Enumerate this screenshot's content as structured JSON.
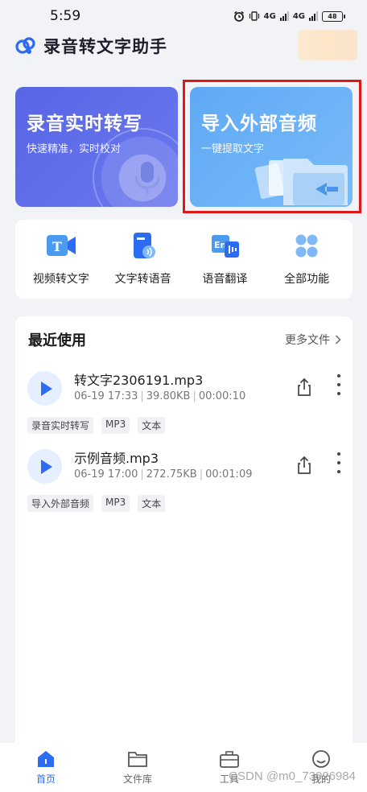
{
  "status": {
    "time": "5:59",
    "network1": "4G",
    "network2": "4G",
    "battery": "48"
  },
  "header": {
    "title": "录音转文字助手"
  },
  "cards": {
    "record": {
      "title": "录音实时转写",
      "subtitle": "快速精准，实时校对"
    },
    "import": {
      "title": "导入外部音频",
      "subtitle": "一键提取文字"
    }
  },
  "functions": [
    {
      "label": "视频转文字",
      "icon": "video-to-text-icon"
    },
    {
      "label": "文字转语音",
      "icon": "text-to-speech-icon"
    },
    {
      "label": "语音翻译",
      "icon": "voice-translate-icon"
    },
    {
      "label": "全部功能",
      "icon": "all-functions-icon"
    }
  ],
  "recent": {
    "title": "最近使用",
    "more": "更多文件",
    "files": [
      {
        "name": "转文字2306191.mp3",
        "date": "06-19 17:33",
        "size": "39.80KB",
        "duration": "00:00:10",
        "tags": [
          "录音实时转写",
          "MP3",
          "文本"
        ]
      },
      {
        "name": "示例音频.mp3",
        "date": "06-19 17:00",
        "size": "272.75KB",
        "duration": "00:01:09",
        "tags": [
          "导入外部音频",
          "MP3",
          "文本"
        ]
      }
    ]
  },
  "tabs": [
    {
      "label": "首页",
      "icon": "home-icon",
      "active": true
    },
    {
      "label": "文件库",
      "icon": "folder-icon",
      "active": false
    },
    {
      "label": "工具",
      "icon": "toolbox-icon",
      "active": false
    },
    {
      "label": "我的",
      "icon": "profile-icon",
      "active": false
    }
  ],
  "watermark": "CSDN @m0_73026984",
  "colors": {
    "accent": "#2d6cf1",
    "record_card": "#5866e6",
    "import_card": "#6aaff6",
    "highlight": "#e01818"
  }
}
